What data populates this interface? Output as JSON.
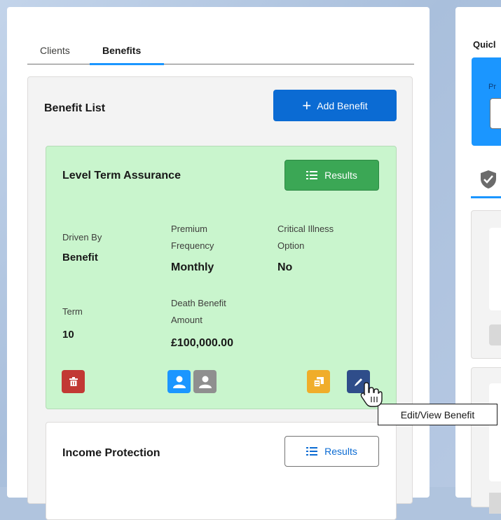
{
  "tabs": [
    {
      "label": "Clients",
      "active": false
    },
    {
      "label": "Benefits",
      "active": true
    }
  ],
  "benefit_list": {
    "title": "Benefit List",
    "add_button_label": "Add Benefit"
  },
  "benefits": [
    {
      "title": "Level Term Assurance",
      "results_label": "Results",
      "fields": {
        "driven_by_label": "Driven By",
        "driven_by_value": "Benefit",
        "premium_frequency_label_line1": "Premium",
        "premium_frequency_label_line2": "Frequency",
        "premium_frequency_value": "Monthly",
        "critical_illness_label_line1": "Critical Illness",
        "critical_illness_label_line2": "Option",
        "critical_illness_value": "No",
        "term_label": "Term",
        "term_value": "10",
        "death_benefit_label_line1": "Death Benefit",
        "death_benefit_label_line2": "Amount",
        "death_benefit_value": "£100,000.00"
      }
    },
    {
      "title": "Income Protection",
      "results_label": "Results"
    }
  ],
  "right_panel": {
    "title": "Quicl",
    "field_label": "Pr"
  },
  "tooltip": "Edit/View Benefit",
  "colors": {
    "primary": "#0b6bd3",
    "success": "#3ba755",
    "danger": "#c23934",
    "card_green_bg": "#c9f5cd"
  }
}
